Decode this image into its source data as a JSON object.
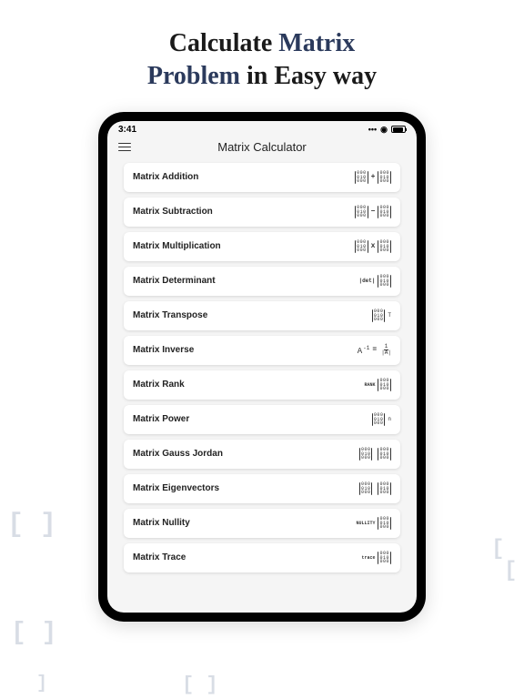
{
  "headline": {
    "part1": "Calculate ",
    "accent1": "Matrix",
    "br": " ",
    "accent2": "Problem",
    "part2": " in Easy way"
  },
  "status": {
    "time": "3:41"
  },
  "app": {
    "title": "Matrix Calculator"
  },
  "options": [
    {
      "label": "Matrix Addition",
      "iconType": "addition",
      "op": "+"
    },
    {
      "label": "Matrix Subtraction",
      "iconType": "subtraction",
      "op": "−"
    },
    {
      "label": "Matrix Multiplication",
      "iconType": "multiplication",
      "op": "x"
    },
    {
      "label": "Matrix Determinant",
      "iconType": "determinant",
      "left": "|det|"
    },
    {
      "label": "Matrix Transpose",
      "iconType": "transpose",
      "sup": "T"
    },
    {
      "label": "Matrix Inverse",
      "iconType": "inverse",
      "left": "A",
      "sup": "-1",
      "eq": "=",
      "fracTop": "1",
      "fracBot": "|A|"
    },
    {
      "label": "Matrix Rank",
      "iconType": "rank",
      "left": "RANK"
    },
    {
      "label": "Matrix Power",
      "iconType": "power",
      "sup": "n"
    },
    {
      "label": "Matrix Gauss Jordan",
      "iconType": "gaussjordan"
    },
    {
      "label": "Matrix Eigenvectors",
      "iconType": "eigen"
    },
    {
      "label": "Matrix Nullity",
      "iconType": "nullity",
      "left": "NULLITY"
    },
    {
      "label": "Matrix Trace",
      "iconType": "trace",
      "left": "trace"
    }
  ]
}
